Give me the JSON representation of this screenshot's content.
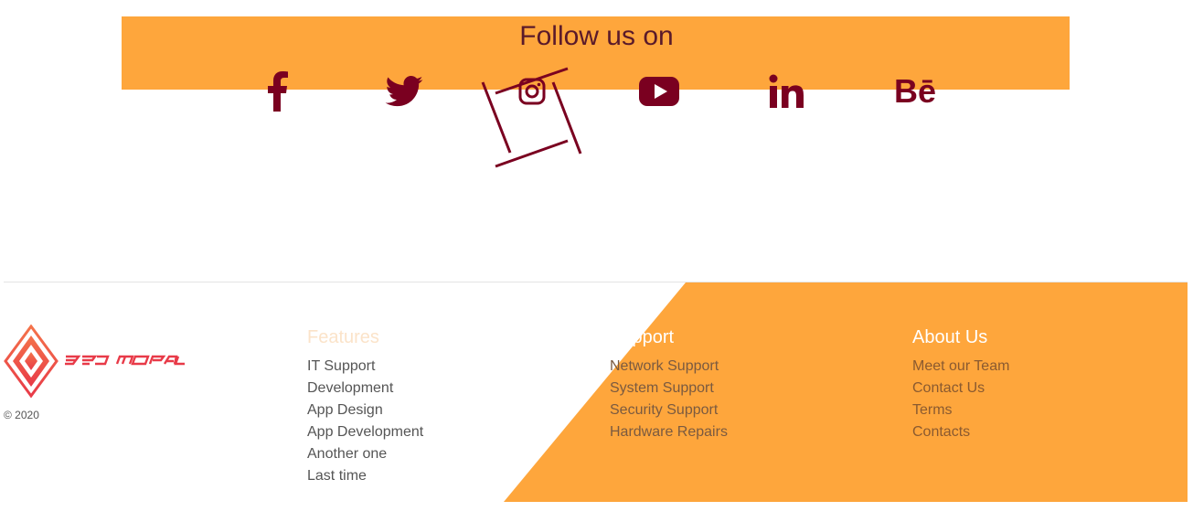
{
  "colors": {
    "accent_orange": "#fea63c",
    "icon_maroon": "#7a0020",
    "divider": "#e4e4e4"
  },
  "follow": {
    "title": "Follow us on",
    "socials": [
      {
        "name": "facebook",
        "icon": "facebook-icon"
      },
      {
        "name": "twitter",
        "icon": "twitter-icon"
      },
      {
        "name": "instagram",
        "icon": "instagram-icon"
      },
      {
        "name": "youtube",
        "icon": "youtube-icon"
      },
      {
        "name": "linkedin",
        "icon": "linkedin-icon",
        "glyph": "in"
      },
      {
        "name": "behance",
        "icon": "behance-icon",
        "glyph": "Bē"
      }
    ]
  },
  "footer": {
    "brand": {
      "logo_text": "3RD MORAL",
      "copyright": "© 2020"
    },
    "features": {
      "heading": "Features",
      "items": [
        "IT Support",
        "Development",
        "App Design",
        "App Development",
        "Another one",
        "Last time"
      ]
    },
    "support": {
      "heading": "Support",
      "items": [
        "Network Support",
        "System Support",
        "Security Support",
        "Hardware Repairs"
      ]
    },
    "about": {
      "heading": "About Us",
      "items": [
        "Meet our Team",
        "Contact Us",
        "Terms",
        "Contacts"
      ]
    }
  }
}
